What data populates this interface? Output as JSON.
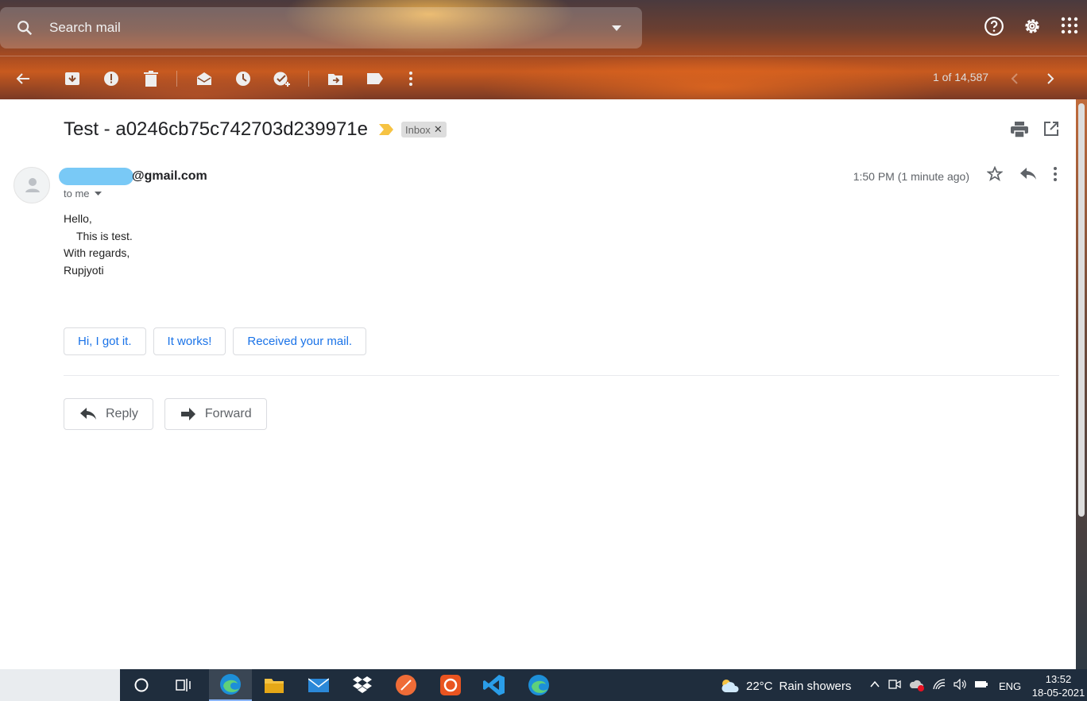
{
  "search": {
    "placeholder": "Search mail"
  },
  "toolbar": {
    "pager": "1 of 14,587"
  },
  "message": {
    "subject": "Test - a0246cb75c742703d239971e",
    "label": "Inbox",
    "sender_email": "@gmail.com",
    "recipient": "to me",
    "time": "1:50 PM (1 minute ago)",
    "body": [
      "Hello,",
      "This is test.",
      "With regards,",
      "Rupjyoti"
    ]
  },
  "smart_replies": [
    "Hi, I got it.",
    "It works!",
    "Received your mail."
  ],
  "actions": {
    "reply": "Reply",
    "forward": "Forward"
  },
  "taskbar": {
    "weather": {
      "temp": "22°C",
      "desc": "Rain showers"
    },
    "language": "ENG",
    "time": "13:52",
    "date": "18-05-2021"
  },
  "colors": {
    "accent": "#1a73e8",
    "redaction": "#79c9f6",
    "important": "#f6c343"
  }
}
